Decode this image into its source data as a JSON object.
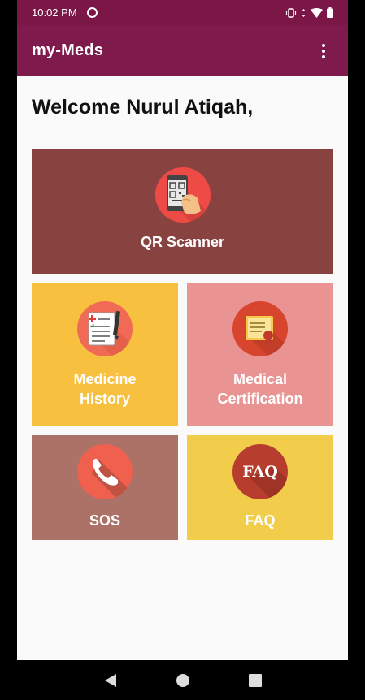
{
  "status_bar": {
    "time": "10:02 PM"
  },
  "app_bar": {
    "title": "my-Meds",
    "menu_icon": "more-vert-icon"
  },
  "welcome": "Welcome Nurul Atiqah,",
  "tiles": [
    {
      "label": "QR Scanner",
      "icon": "qr-phone-icon",
      "color": "#884341"
    },
    {
      "label_line1": "Medicine",
      "label_line2": "History",
      "icon": "clipboard-icon",
      "color": "#f8c03f"
    },
    {
      "label_line1": "Medical",
      "label_line2": "Certification",
      "icon": "certificate-icon",
      "color": "#e99393"
    },
    {
      "label": "SOS",
      "icon": "phone-icon",
      "color": "#ac7167"
    },
    {
      "label": "FAQ",
      "icon": "faq-icon",
      "icon_text": "FAQ",
      "color": "#f2cd4c"
    }
  ],
  "colors": {
    "primary": "#7f1a4c",
    "background": "#fafafa"
  }
}
